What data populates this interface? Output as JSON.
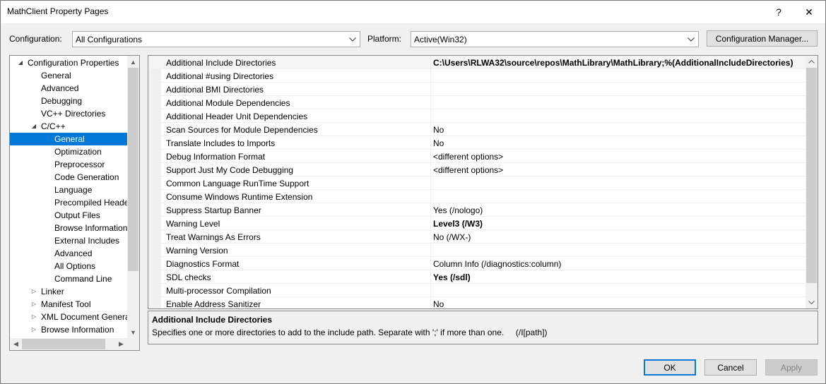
{
  "window": {
    "title": "MathClient Property Pages",
    "help_glyph": "?",
    "close_glyph": "✕"
  },
  "config": {
    "configuration_label": "Configuration:",
    "configuration_value": "All Configurations",
    "platform_label": "Platform:",
    "platform_value": "Active(Win32)",
    "manager_button": "Configuration Manager..."
  },
  "tree": {
    "items": [
      {
        "label": "Configuration Properties",
        "level": 0,
        "expander": "◢"
      },
      {
        "label": "General",
        "level": 1,
        "expander": ""
      },
      {
        "label": "Advanced",
        "level": 1,
        "expander": ""
      },
      {
        "label": "Debugging",
        "level": 1,
        "expander": ""
      },
      {
        "label": "VC++ Directories",
        "level": 1,
        "expander": ""
      },
      {
        "label": "C/C++",
        "level": 1,
        "expander": "◢"
      },
      {
        "label": "General",
        "level": 2,
        "expander": "",
        "selected": true
      },
      {
        "label": "Optimization",
        "level": 2,
        "expander": ""
      },
      {
        "label": "Preprocessor",
        "level": 2,
        "expander": ""
      },
      {
        "label": "Code Generation",
        "level": 2,
        "expander": ""
      },
      {
        "label": "Language",
        "level": 2,
        "expander": ""
      },
      {
        "label": "Precompiled Heade",
        "level": 2,
        "expander": ""
      },
      {
        "label": "Output Files",
        "level": 2,
        "expander": ""
      },
      {
        "label": "Browse Information",
        "level": 2,
        "expander": ""
      },
      {
        "label": "External Includes",
        "level": 2,
        "expander": ""
      },
      {
        "label": "Advanced",
        "level": 2,
        "expander": ""
      },
      {
        "label": "All Options",
        "level": 2,
        "expander": ""
      },
      {
        "label": "Command Line",
        "level": 2,
        "expander": ""
      },
      {
        "label": "Linker",
        "level": 1,
        "expander": "▷"
      },
      {
        "label": "Manifest Tool",
        "level": 1,
        "expander": "▷"
      },
      {
        "label": "XML Document Genera",
        "level": 1,
        "expander": "▷"
      },
      {
        "label": "Browse Information",
        "level": 1,
        "expander": "▷"
      }
    ]
  },
  "properties": [
    {
      "name": "Additional Include Directories",
      "value": "C:\\Users\\RLWA32\\source\\repos\\MathLibrary\\MathLibrary;%(AdditionalIncludeDirectories)",
      "bold": true
    },
    {
      "name": "Additional #using Directories",
      "value": "",
      "bold": false
    },
    {
      "name": "Additional BMI Directories",
      "value": "",
      "bold": false
    },
    {
      "name": "Additional Module Dependencies",
      "value": "",
      "bold": false
    },
    {
      "name": "Additional Header Unit Dependencies",
      "value": "",
      "bold": false
    },
    {
      "name": "Scan Sources for Module Dependencies",
      "value": "No",
      "bold": false
    },
    {
      "name": "Translate Includes to Imports",
      "value": "No",
      "bold": false
    },
    {
      "name": "Debug Information Format",
      "value": "<different options>",
      "bold": false
    },
    {
      "name": "Support Just My Code Debugging",
      "value": "<different options>",
      "bold": false
    },
    {
      "name": "Common Language RunTime Support",
      "value": "",
      "bold": false
    },
    {
      "name": "Consume Windows Runtime Extension",
      "value": "",
      "bold": false
    },
    {
      "name": "Suppress Startup Banner",
      "value": "Yes (/nologo)",
      "bold": false
    },
    {
      "name": "Warning Level",
      "value": "Level3 (/W3)",
      "bold": true
    },
    {
      "name": "Treat Warnings As Errors",
      "value": "No (/WX-)",
      "bold": false
    },
    {
      "name": "Warning Version",
      "value": "",
      "bold": false
    },
    {
      "name": "Diagnostics Format",
      "value": "Column Info (/diagnostics:column)",
      "bold": false
    },
    {
      "name": "SDL checks",
      "value": "Yes (/sdl)",
      "bold": true
    },
    {
      "name": "Multi-processor Compilation",
      "value": "",
      "bold": false
    },
    {
      "name": "Enable Address Sanitizer",
      "value": "No",
      "bold": false
    }
  ],
  "selected_property_index": 0,
  "description": {
    "title": "Additional Include Directories",
    "text": "Specifies one or more directories to add to the include path. Separate with ';' if more than one.     (/I[path])"
  },
  "buttons": {
    "ok": "OK",
    "cancel": "Cancel",
    "apply": "Apply"
  },
  "colors": {
    "selection": "#0078d7",
    "window_bg": "#f0f0f0"
  }
}
